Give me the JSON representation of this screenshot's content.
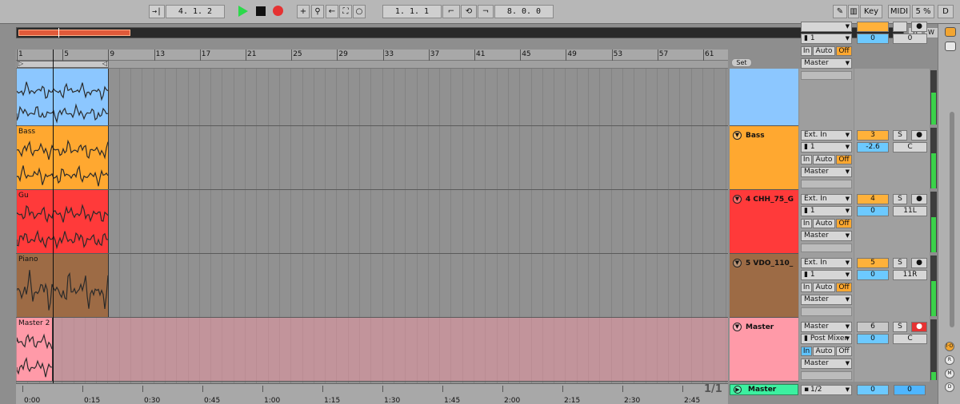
{
  "transport": {
    "follow_icon": "follow-arrow-icon",
    "position": "4.  1.  2",
    "loop_start": "1.  1.  1",
    "loop_length": "8.  0.  0",
    "play_icon": "play-icon",
    "stop_icon": "stop-icon",
    "record_icon": "record-icon"
  },
  "toolbar_right": {
    "key": "Key",
    "midi": "MIDI",
    "cpu": "5 %",
    "d": "D"
  },
  "overview": {
    "h": "H",
    "w": "W"
  },
  "ruler": {
    "bars": [
      "1",
      "5",
      "9",
      "13",
      "17",
      "21",
      "25",
      "29",
      "33",
      "37",
      "41",
      "45",
      "49",
      "53",
      "57",
      "61"
    ]
  },
  "set_button": "Set",
  "time_ruler": [
    "0:00",
    "0:15",
    "0:30",
    "0:45",
    "1:00",
    "1:15",
    "1:30",
    "1:45",
    "2:00",
    "2:15",
    "2:30",
    "2:45"
  ],
  "pager": "1/1",
  "tracks": [
    {
      "clip_name": "",
      "name": "",
      "input": "",
      "channel": "1",
      "monitor": [
        "In",
        "Auto",
        "Off"
      ],
      "output": "Master",
      "number": "",
      "volume": "0",
      "pan": "0",
      "color": "#8cc7ff",
      "clip_color": "#8cc7ff"
    },
    {
      "clip_name": "Bass",
      "name": "Bass",
      "input": "Ext. In",
      "channel": "1",
      "monitor": [
        "In",
        "Auto",
        "Off"
      ],
      "output": "Master",
      "number": "3",
      "solo": "S",
      "volume": "-2.6",
      "pan": "C",
      "color": "#ffa830",
      "clip_color": "#ffa830"
    },
    {
      "clip_name": "Gu",
      "name": "4 CHH_75_G",
      "input": "Ext. In",
      "channel": "1",
      "monitor": [
        "In",
        "Auto",
        "Off"
      ],
      "output": "Master",
      "number": "4",
      "solo": "S",
      "volume": "0",
      "pan": "11L",
      "color": "#ff3a3a",
      "clip_color": "#ff3a3a"
    },
    {
      "clip_name": "Piano",
      "name": "5 VDO_110_",
      "input": "Ext. In",
      "channel": "1",
      "monitor": [
        "In",
        "Auto",
        "Off"
      ],
      "output": "Master",
      "number": "5",
      "solo": "S",
      "volume": "0",
      "pan": "11R",
      "color": "#9d6b45",
      "clip_color": "#9d6b45"
    },
    {
      "clip_name": "Master 2",
      "name": "Master",
      "input": "Master",
      "channel": "Post Mixer",
      "monitor": [
        "In",
        "Auto",
        "Off"
      ],
      "output": "Master",
      "number": "6",
      "solo": "S",
      "volume": "0",
      "pan": "C",
      "color": "#ff9aa8",
      "clip_color": "#ff9aa8"
    }
  ],
  "master": {
    "name": "Master",
    "output": "1/2",
    "volume": "0",
    "pan": "0",
    "color": "#3cf0a0"
  },
  "right_strip": [
    "I·O",
    "R",
    "M",
    "D"
  ]
}
